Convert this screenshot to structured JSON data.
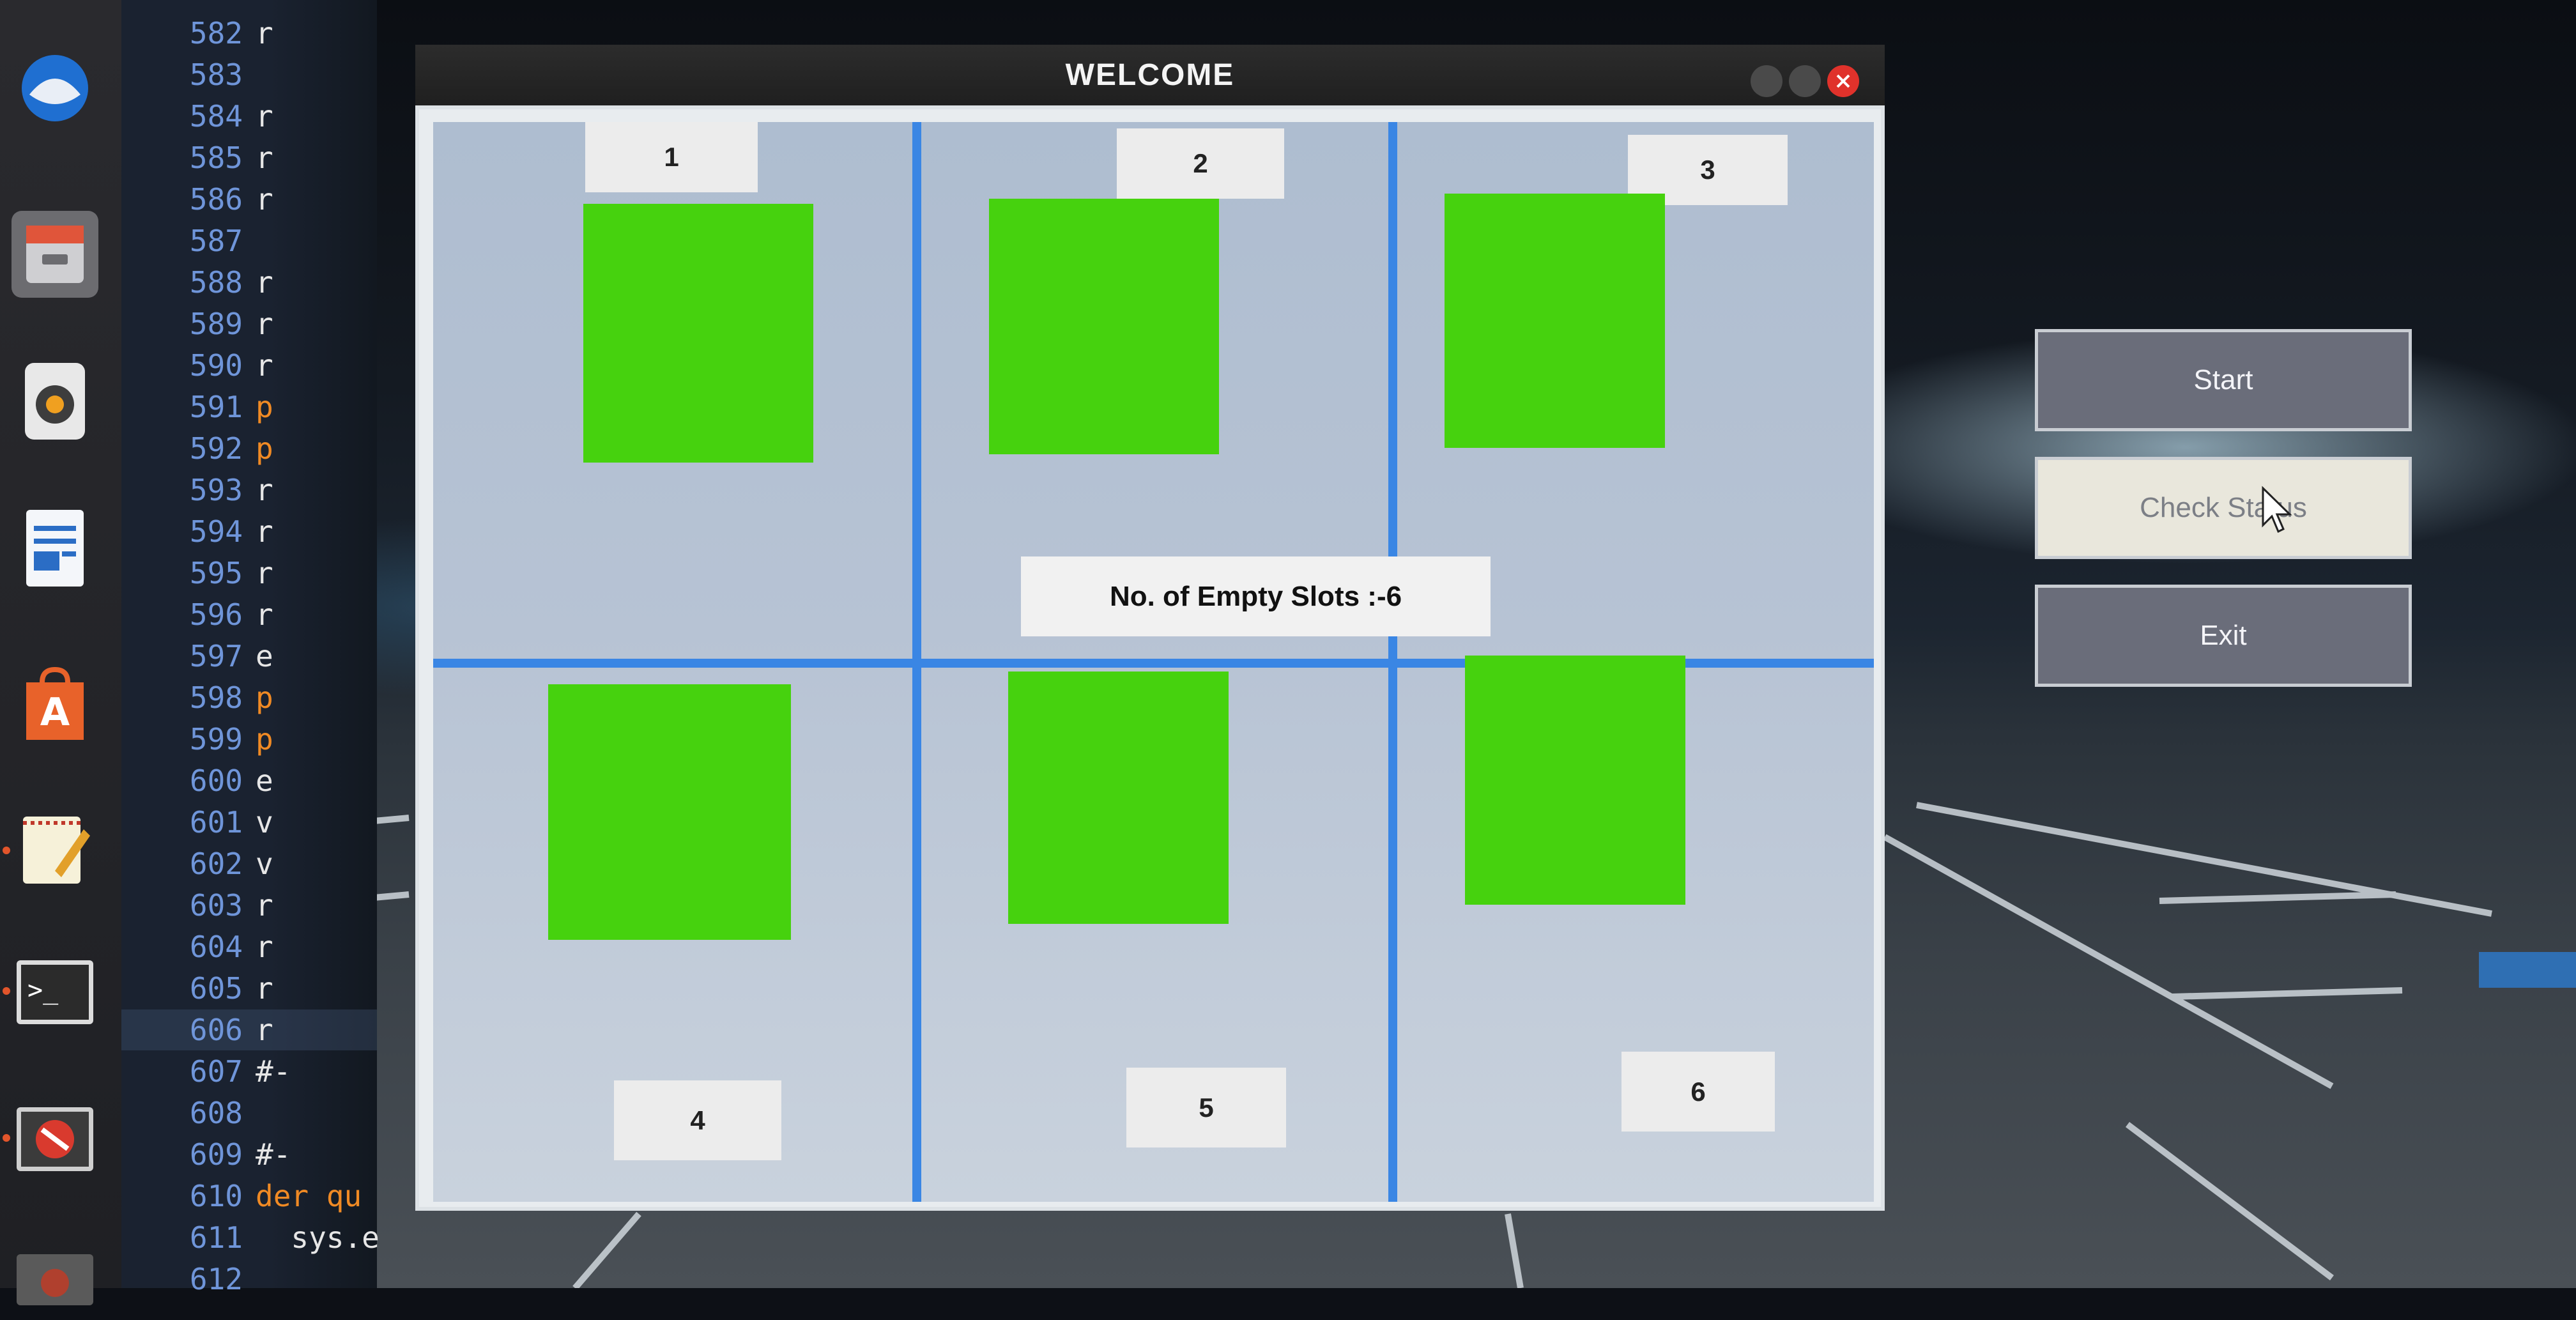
{
  "window": {
    "title": "WELCOME"
  },
  "editor": {
    "lines": [
      {
        "num": "582",
        "code": "r"
      },
      {
        "num": "583",
        "code": ""
      },
      {
        "num": "584",
        "code": "r"
      },
      {
        "num": "585",
        "code": "r"
      },
      {
        "num": "586",
        "code": "r"
      },
      {
        "num": "587",
        "code": ""
      },
      {
        "num": "588",
        "code": "r"
      },
      {
        "num": "589",
        "code": "r"
      },
      {
        "num": "590",
        "code": "r"
      },
      {
        "num": "591",
        "code": "p"
      },
      {
        "num": "592",
        "code": "p"
      },
      {
        "num": "593",
        "code": "r"
      },
      {
        "num": "594",
        "code": "r"
      },
      {
        "num": "595",
        "code": "r"
      },
      {
        "num": "596",
        "code": "r"
      },
      {
        "num": "597",
        "code": "e"
      },
      {
        "num": "598",
        "code": "p"
      },
      {
        "num": "599",
        "code": "p"
      },
      {
        "num": "600",
        "code": "e"
      },
      {
        "num": "601",
        "code": "v"
      },
      {
        "num": "602",
        "code": "v"
      },
      {
        "num": "603",
        "code": "r"
      },
      {
        "num": "604",
        "code": "r"
      },
      {
        "num": "605",
        "code": "r"
      },
      {
        "num": "606",
        "code": "r"
      },
      {
        "num": "607",
        "code": "#-"
      },
      {
        "num": "608",
        "code": ""
      },
      {
        "num": "609",
        "code": "#-"
      },
      {
        "num": "610",
        "code": "der qu"
      },
      {
        "num": "611",
        "code": "  sys.e"
      },
      {
        "num": "612",
        "code": ""
      }
    ]
  },
  "slots": {
    "labels": [
      "1",
      "2",
      "3",
      "4",
      "5",
      "6"
    ],
    "color": "#46d20e",
    "empty_count_text": "No. of Empty Slots :-6"
  },
  "side_panel": {
    "start_label": "Start",
    "check_status_label": "Check Status",
    "exit_label": "Exit"
  },
  "dock": {
    "icons": [
      "thunderbird-icon",
      "files-icon",
      "speaker-icon",
      "writer-icon",
      "software-center-icon",
      "text-editor-icon",
      "terminal-icon",
      "blocked-icon",
      "app-icon"
    ]
  },
  "colors": {
    "grid_line": "#3a86e4",
    "slot_fill": "#46d20e",
    "button_dark": "#6a6d7a",
    "button_light": "#e9e7dc"
  }
}
